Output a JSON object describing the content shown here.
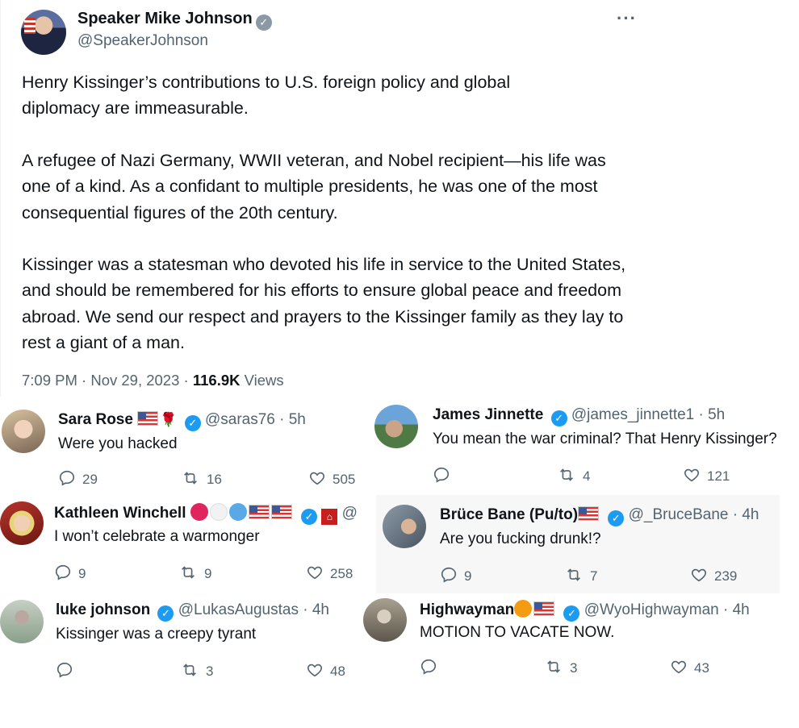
{
  "main": {
    "author_name": "Speaker Mike Johnson",
    "author_handle": "@SpeakerJohnson",
    "paragraphs": [
      "Henry Kissinger’s contributions to U.S. foreign policy and global diplomacy are immeasurable.",
      "A refugee of Nazi Germany, WWII veteran, and Nobel recipient—his life was one of a kind. As a confidant to multiple presidents, he was one of the most consequential figures of the 20th century.",
      "Kissinger was a statesman who devoted his life in service to the United States, and should be remembered for his efforts to ensure global peace and freedom abroad. We send our respect and prayers to the Kissinger family as they lay to rest a giant of a man."
    ],
    "timestamp": "7:09 PM · Nov 29, 2023 · ",
    "views_count": "116.9K",
    "views_label": " Views"
  },
  "replies": [
    {
      "name": "Sara Rose",
      "handle": "@saras76 · 5h",
      "text": "Were you hacked",
      "comments": "29",
      "retweets": "16",
      "likes": "505"
    },
    {
      "name": "James Jinnette",
      "handle": "@james_jinnette1 · 5h",
      "text": "You mean the war criminal? That Henry Kissinger?",
      "comments": "",
      "retweets": "4",
      "likes": "121"
    },
    {
      "name": "Kathleen Winchell",
      "handle": "@",
      "text": "I won’t celebrate a warmonger",
      "comments": "9",
      "retweets": "9",
      "likes": "258"
    },
    {
      "name": "Brüce Bane (Pu/to)",
      "handle": "@_BruceBane · 4h",
      "text": "Are you fucking drunk!?",
      "comments": "9",
      "retweets": "7",
      "likes": "239"
    },
    {
      "name": "luke johnson",
      "handle": "@LukasAugustas · 4h",
      "text": "Kissinger was a creepy tyrant",
      "comments": "",
      "retweets": "3",
      "likes": "48"
    },
    {
      "name": "Highwayman",
      "handle": "@WyoHighwayman · 4h",
      "text": "MOTION TO VACATE NOW.",
      "comments": "",
      "retweets": "3",
      "likes": "43"
    }
  ],
  "icons": {
    "verified": "verified-badge-icon",
    "reply": "reply-icon",
    "retweet": "retweet-icon",
    "like": "like-icon",
    "more": "more-icon"
  },
  "colors": {
    "accent": "#1d9bf0",
    "muted": "#536471",
    "text": "#0f1419"
  }
}
